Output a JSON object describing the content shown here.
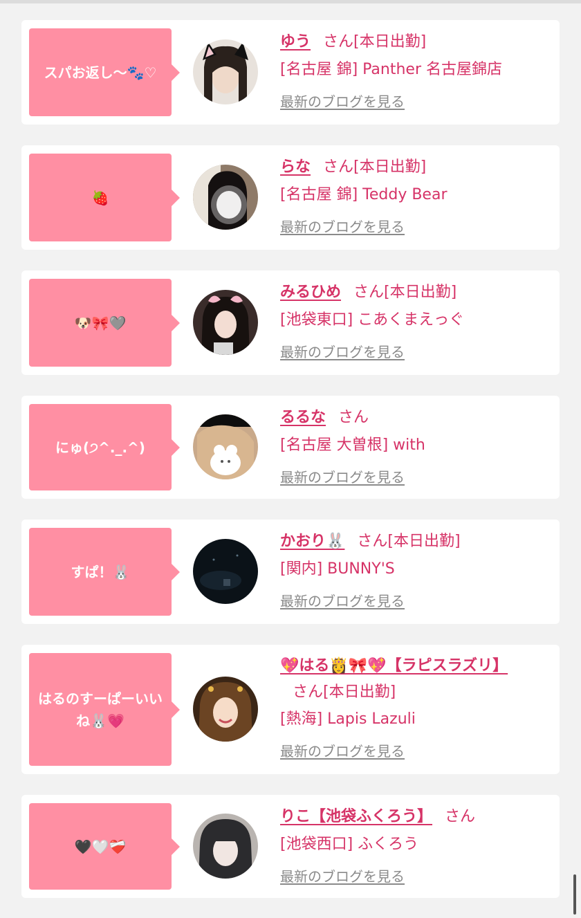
{
  "blog_link_label": "最新のブログを見る",
  "cards": [
    {
      "bubble": "スパお返し〜🐾♡",
      "name": "ゆう",
      "suffix": "さん[本日出勤]",
      "shop": "[名古屋 錦] Panther 名古屋錦店"
    },
    {
      "bubble": "🍓",
      "name": "らな",
      "suffix": "さん[本日出勤]",
      "shop": "[名古屋 錦] Teddy Bear"
    },
    {
      "bubble": "🐶🎀🩶",
      "name": "みるひめ",
      "suffix": "さん[本日出勤]",
      "shop": "[池袋東口] こあくまえっぐ"
    },
    {
      "bubble": "にゅ(੭^._.^)",
      "name": "るるな",
      "suffix": "さん",
      "shop": "[名古屋 大曽根] with"
    },
    {
      "bubble": "すぱ！🐰",
      "name": "かおり🐰",
      "suffix": "さん[本日出勤]",
      "shop": "[関内] BUNNY'S"
    },
    {
      "bubble": "はるのすーぱーいいね🐰💗",
      "name": "💖はる👸🎀💖【ラピスラズリ】",
      "suffix": "さん[本日出勤]",
      "shop": "[熱海] Lapis Lazuli"
    },
    {
      "bubble": "🖤🤍❤️‍🩹",
      "name": "りこ【池袋ふくろう】",
      "suffix": "さん",
      "shop": "[池袋西口] ふくろう"
    }
  ],
  "colors": {
    "bubble": "#ff8fa3",
    "accent_text": "#d63367",
    "link_gray": "#8a8a8a",
    "page_bg": "#f2f2f2"
  }
}
